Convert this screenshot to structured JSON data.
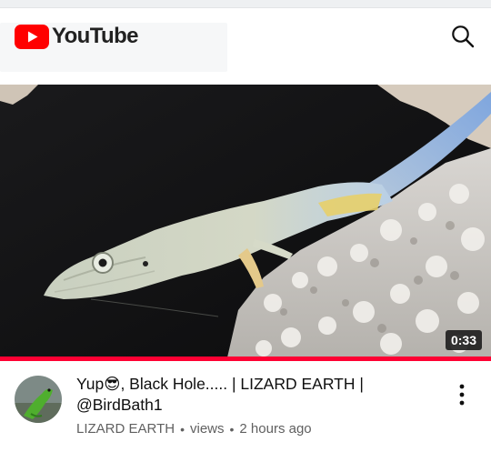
{
  "app": {
    "logo_text": "YouTube",
    "brand_color": "#ff0000"
  },
  "header": {
    "search_icon": "search-icon"
  },
  "video": {
    "duration": "0:33",
    "progress_fraction": 1.0,
    "title_part1": "Yup",
    "title_emoji": "😎",
    "title_part2": ", Black Hole..... | LIZARD EARTH | @BirdBath1",
    "channel": "LIZARD EARTH",
    "views": "views",
    "age": "2 hours ago",
    "separator": "•"
  },
  "colors": {
    "progress": "#ff0033",
    "text_primary": "#0f0f0f",
    "text_secondary": "#606060"
  }
}
